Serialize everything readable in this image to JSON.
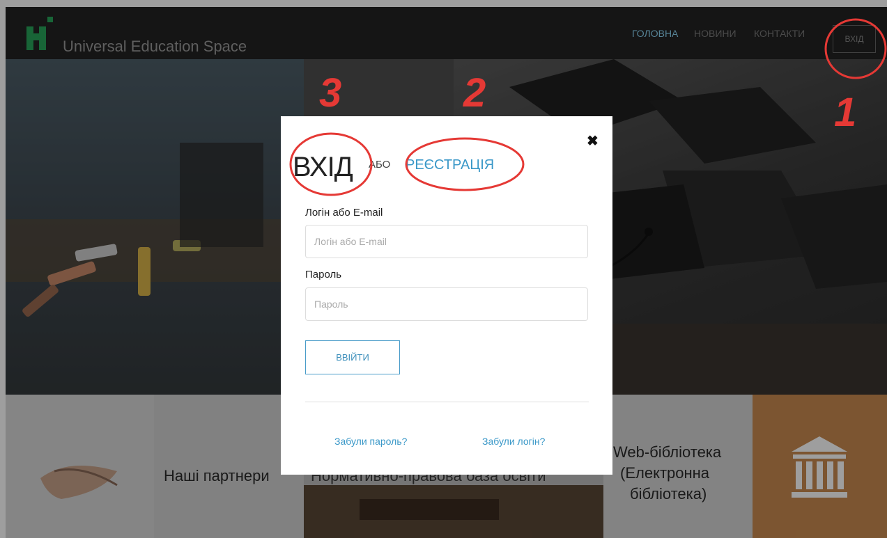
{
  "header": {
    "brand": "Universal Education Space",
    "nav": [
      {
        "label": "ГОЛОВНА"
      },
      {
        "label": "НОВИНИ"
      },
      {
        "label": "КОНТАКТИ"
      }
    ],
    "login_button": "ВХІД"
  },
  "tiles": {
    "partners": "Наші партнери",
    "legal": "Нормативно-правова база освіти",
    "library_line1": "Web-бібліотека",
    "library_line2": "(Електронна",
    "library_line3": "бібліотека)"
  },
  "modal": {
    "title": "ВХІД",
    "or": "АБО",
    "register": "РЕЄСТРАЦІЯ",
    "login_label": "Логін або E-mail",
    "login_placeholder": "Логін або E-mail",
    "login_value": "",
    "password_label": "Пароль",
    "password_placeholder": "Пароль",
    "password_value": "",
    "submit": "ВВІЙТИ",
    "forgot_password": "Забули пароль?",
    "forgot_login": "Забули логін?",
    "close_icon": "close-icon"
  },
  "annotations": [
    "1",
    "2",
    "3"
  ],
  "colors": {
    "accent": "#3a98c8",
    "brand_green": "#27a35a",
    "library_tile": "#c88a4f",
    "annotation_red": "#e53935"
  }
}
